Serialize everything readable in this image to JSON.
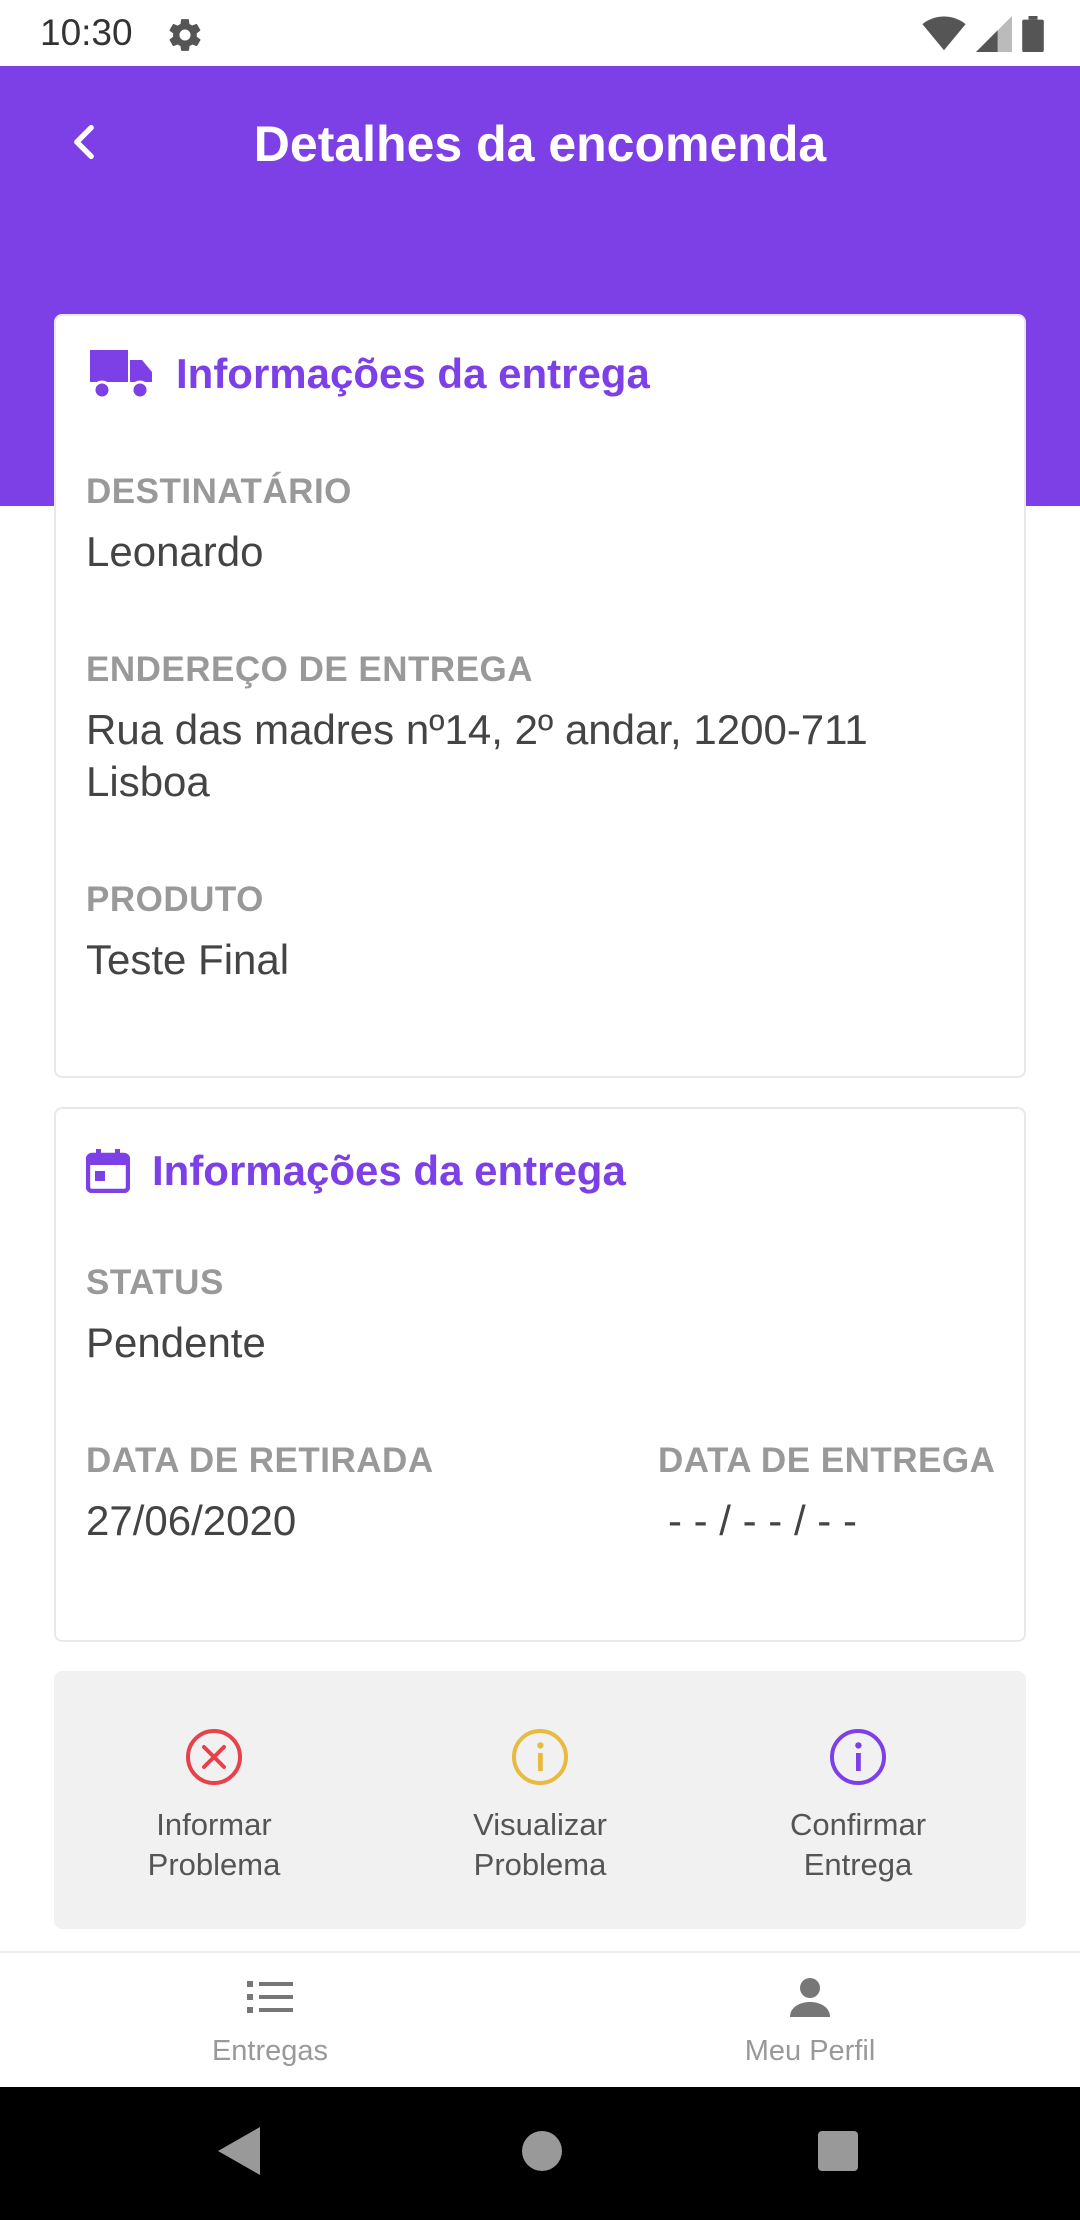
{
  "status_bar": {
    "time": "10:30",
    "icons": [
      "settings-gear-icon",
      "wifi-icon",
      "signal-icon",
      "battery-icon"
    ]
  },
  "header": {
    "title": "Detalhes da encomenda",
    "back_icon": "chevron-left-icon",
    "color": "#7d40e7"
  },
  "delivery_card": {
    "icon": "truck-icon",
    "title": "Informações da entrega",
    "recipient_label": "DESTINATÁRIO",
    "recipient": "Leonardo",
    "address_label": "ENDEREÇO DE ENTREGA",
    "address": "Rua das madres nº14, 2º andar, 1200-711 Lisboa",
    "product_label": "PRODUTO",
    "product": "Teste Final"
  },
  "status_card": {
    "icon": "calendar-icon",
    "title": "Informações da entrega",
    "status_label": "STATUS",
    "status": "Pendente",
    "pickup_label": "DATA DE RETIRADA",
    "pickup_date": "27/06/2020",
    "delivery_label": "DATA DE ENTREGA",
    "delivery_date": "- - / - - / - -"
  },
  "actions": [
    {
      "label": "Informar Problema",
      "icon": "close-circle-icon",
      "color": "#e7414b"
    },
    {
      "label": "Visualizar Problema",
      "icon": "info-circle-icon",
      "color": "#e7ba40"
    },
    {
      "label": "Confirmar Entrega",
      "icon": "info-circle-icon",
      "color": "#7d40e7"
    }
  ],
  "tabs": [
    {
      "label": "Entregas",
      "icon": "list-icon"
    },
    {
      "label": "Meu Perfil",
      "icon": "person-icon"
    }
  ],
  "nav": [
    "back-triangle-icon",
    "home-circle-icon",
    "recents-square-icon"
  ]
}
